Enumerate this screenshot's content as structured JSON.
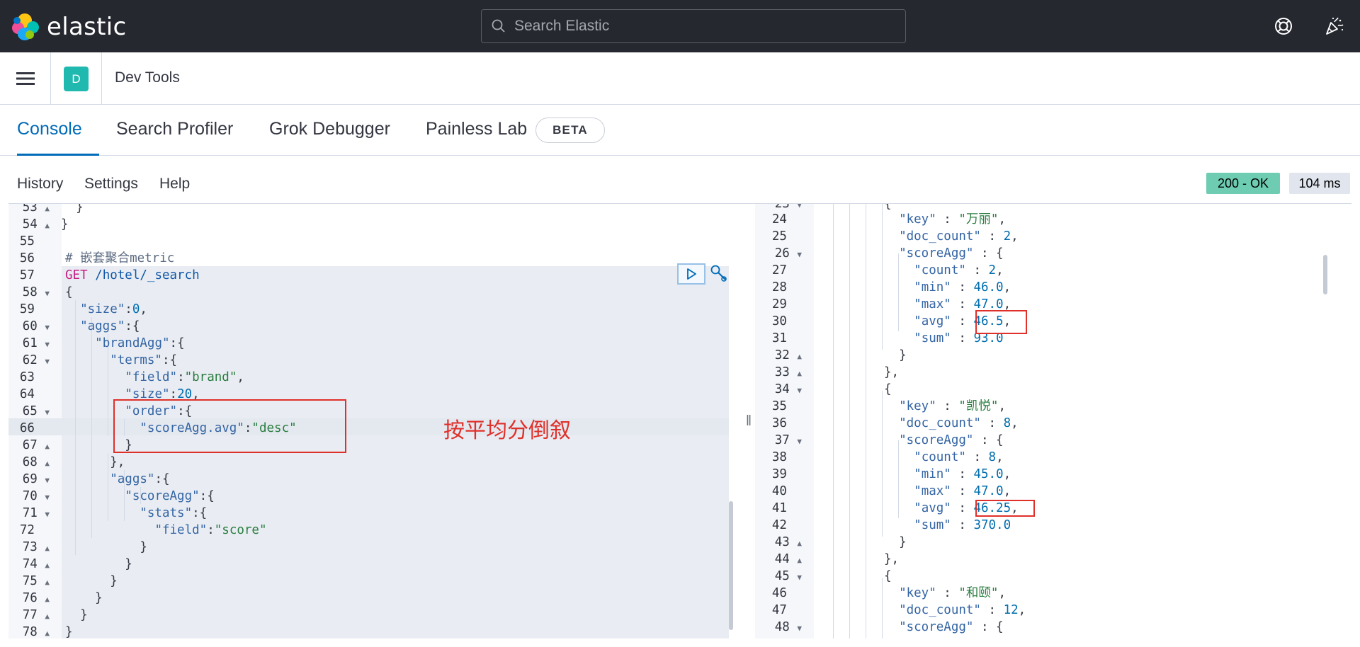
{
  "header": {
    "brand": "elastic",
    "search_placeholder": "Search Elastic",
    "help_icon": "lifesaver-icon",
    "news_icon": "party-popper-icon"
  },
  "subbar": {
    "space_initial": "D",
    "breadcrumb": "Dev Tools"
  },
  "tabs": [
    {
      "label": "Console",
      "active": true
    },
    {
      "label": "Search Profiler",
      "active": false
    },
    {
      "label": "Grok Debugger",
      "active": false
    },
    {
      "label": "Painless Lab",
      "active": false
    }
  ],
  "beta_badge": "BETA",
  "toolbar": {
    "history": "History",
    "settings": "Settings",
    "help": "Help",
    "status": "200 - OK",
    "duration": "104 ms"
  },
  "annotation": "按平均分倒叙",
  "colors": {
    "header_bg": "#25282f",
    "accent": "#006bb8",
    "status_ok": "#6dccb1",
    "space_avatar": "#20b9b0",
    "highlight_red": "#e0302a"
  }
}
